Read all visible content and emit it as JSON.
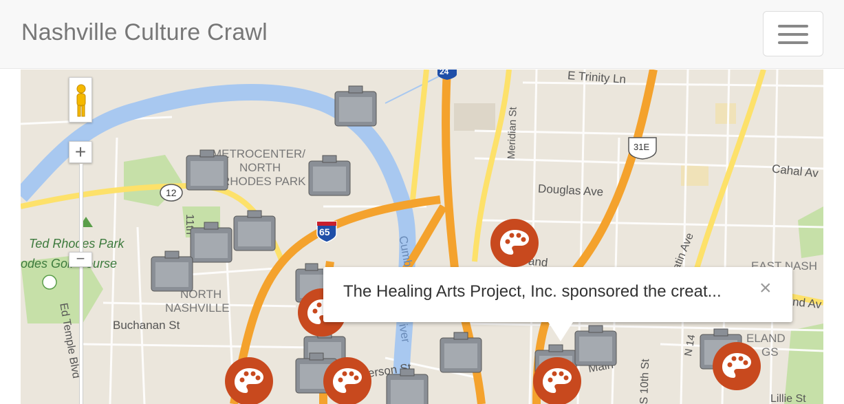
{
  "navbar": {
    "brand": "Nashville Culture Crawl",
    "menu_toggle_icon": "hamburger-icon"
  },
  "map": {
    "colors": {
      "land": "#ebe6dc",
      "river": "#a8c8f0",
      "highway": "#f4a22d",
      "arterial": "#fde16a",
      "park": "#c6e0a8",
      "artwork_marker": "#c8491e"
    },
    "labels": {
      "trinity": "E Trinity Ln",
      "meridian": "Meridian St",
      "us31e": "31E",
      "cahal": "Cahal Av",
      "douglas": "Douglas Ave",
      "metrocenter1": "METROCENTER/",
      "metrocenter2": "NORTH",
      "metrocenter3": "RHODES PARK",
      "route12": "12",
      "eleventh": "11th",
      "i65": "65",
      "i24": "24",
      "cumb": "Cumb",
      "tedrhodes": "Ted Rhodes Park",
      "golf": "odes Golf Course",
      "northnash1": "NORTH",
      "northnash2": "NASHVILLE",
      "buchanan": "Buchanan St",
      "edtemple": "Ed Temple Blvd",
      "river": "iver",
      "jefferson": "ferson St",
      "main": "Main",
      "tenth": "S 10th St",
      "matin": "Matin Ave",
      "eastnash": "EAST NASH",
      "andav": "nd Av",
      "cleveland1": "ELAND",
      "cleveland2": "GS",
      "n14": "N 14",
      "lilli": "Lillie St",
      "grand": "and"
    },
    "controls": {
      "zoom_in": "+",
      "zoom_out": "−"
    },
    "popup": {
      "text": "The Healing Arts Project, Inc. sponsored the creat...",
      "close": "×"
    }
  }
}
